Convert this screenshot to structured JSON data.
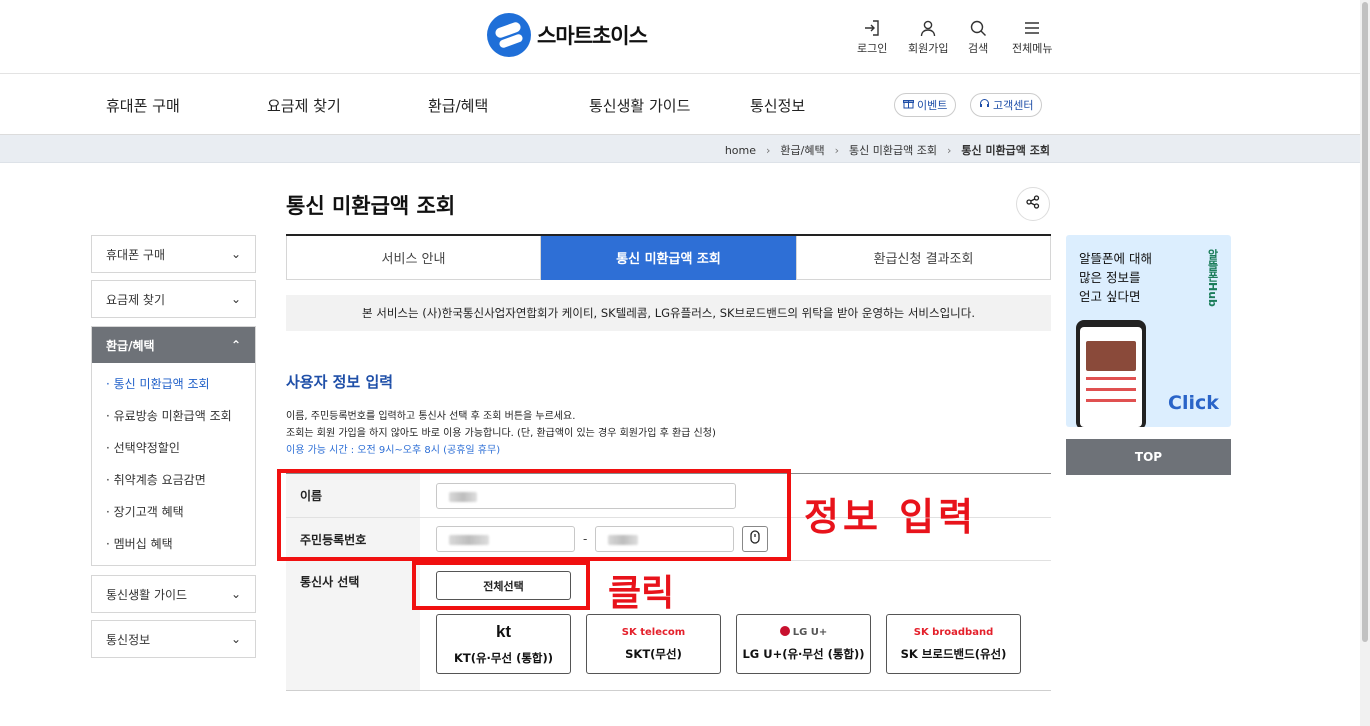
{
  "header": {
    "logo_text": "스마트초이스",
    "util": [
      {
        "label": "로그인",
        "icon": "login-icon"
      },
      {
        "label": "회원가입",
        "icon": "user-icon"
      },
      {
        "label": "검색",
        "icon": "search-icon"
      },
      {
        "label": "전체메뉴",
        "icon": "menu-icon"
      }
    ]
  },
  "gnb": {
    "items": [
      "휴대폰 구매",
      "요금제 찾기",
      "환급/혜택",
      "통신생활 가이드",
      "통신정보"
    ],
    "event": "이벤트",
    "support": "고객센터"
  },
  "breadcrumb": [
    "home",
    "환급/혜택",
    "통신 미환급액 조회",
    "통신 미환급액 조회"
  ],
  "lnb": {
    "groups": [
      "휴대폰 구매",
      "요금제 찾기",
      "환급/혜택",
      "통신생활 가이드",
      "통신정보"
    ],
    "sub": [
      "· 통신 미환급액 조회",
      "· 유료방송 미환급액 조회",
      "· 선택약정할인",
      "· 취약계층 요금감면",
      "· 장기고객 혜택",
      "· 멤버십 혜택"
    ]
  },
  "main": {
    "title": "통신 미환급액 조회",
    "tabs": [
      "서비스 안내",
      "통신 미환급액 조회",
      "환급신청 결과조회"
    ],
    "notice": "본 서비스는 (사)한국통신사업자연합회가 케이티, SK텔레콤, LG유플러스, SK브로드밴드의 위탁을 받아 운영하는 서비스입니다.",
    "section_title": "사용자 정보 입력",
    "desc1": "이름, 주민등록번호를 입력하고 통신사 선택 후 조회 버튼을 누르세요.",
    "desc2": "조회는 회원 가입을 하지 않아도 바로 이용 가능합니다. (단, 환급액이 있는 경우 회원가입 후 환급 신청)",
    "desc3": "이용 가능 시간 : 오전 9시~오후 8시 (공휴일 휴무)",
    "form": {
      "name_label": "이름",
      "rrn_label": "주민등록번호",
      "rrn_dash": "-",
      "carrier_label": "통신사 선택",
      "select_all": "전체선택"
    },
    "carriers": [
      {
        "logo": "kt",
        "name": "KT(유·무선 (통합))"
      },
      {
        "logo": "SK telecom",
        "name": "SKT(무선)"
      },
      {
        "logo": "LG U+",
        "name": "LG U+(유·무선 (통합))"
      },
      {
        "logo": "SK broadband",
        "name": "SK 브로드밴드(유선)"
      }
    ]
  },
  "annotations": {
    "info_input": "정보 입력",
    "click": "클릭",
    "color": "#e8131b"
  },
  "banner": {
    "line1": "알뜰폰에 대해",
    "line2": "많은 정보를",
    "line3": "얻고 싶다면",
    "vertical": "알뜰폰Hub",
    "click": "Click"
  },
  "top_button": "TOP"
}
